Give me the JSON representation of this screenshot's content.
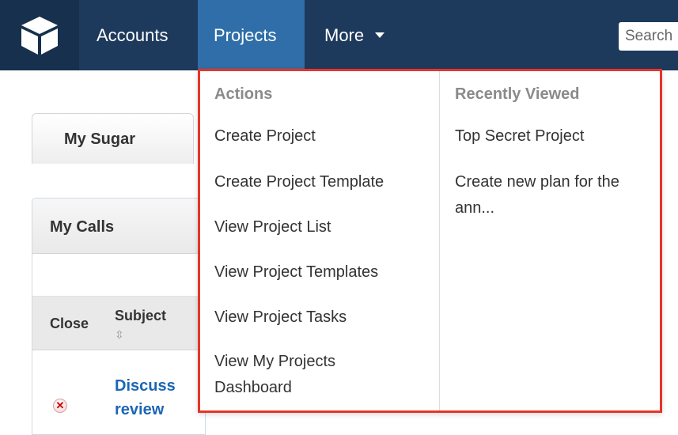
{
  "nav": {
    "logo_icon": "sugar-cube-icon",
    "tabs": [
      {
        "label": "Accounts"
      },
      {
        "label": "Projects"
      },
      {
        "label": "More"
      }
    ],
    "search_placeholder": "Search"
  },
  "page": {
    "tab_label": "My Sugar",
    "dashlet_title": "My Calls",
    "columns": {
      "close": "Close",
      "subject": "Subject"
    },
    "sort_glyph": "⇳",
    "row": {
      "subject": "Discuss review",
      "remove_glyph": "✕"
    }
  },
  "menu": {
    "actions_title": "Actions",
    "actions": [
      "Create Project",
      "Create Project Template",
      "View Project List",
      "View Project Templates",
      "View Project Tasks",
      "View My Projects Dashboard"
    ],
    "recent_title": "Recently Viewed",
    "recent": [
      "Top Secret Project",
      "Create new plan for the ann..."
    ]
  },
  "colors": {
    "nav_bg": "#1d3a5c",
    "active_tab": "#2f6ea8",
    "highlight_border": "#e8342a",
    "link": "#1b66b5"
  }
}
